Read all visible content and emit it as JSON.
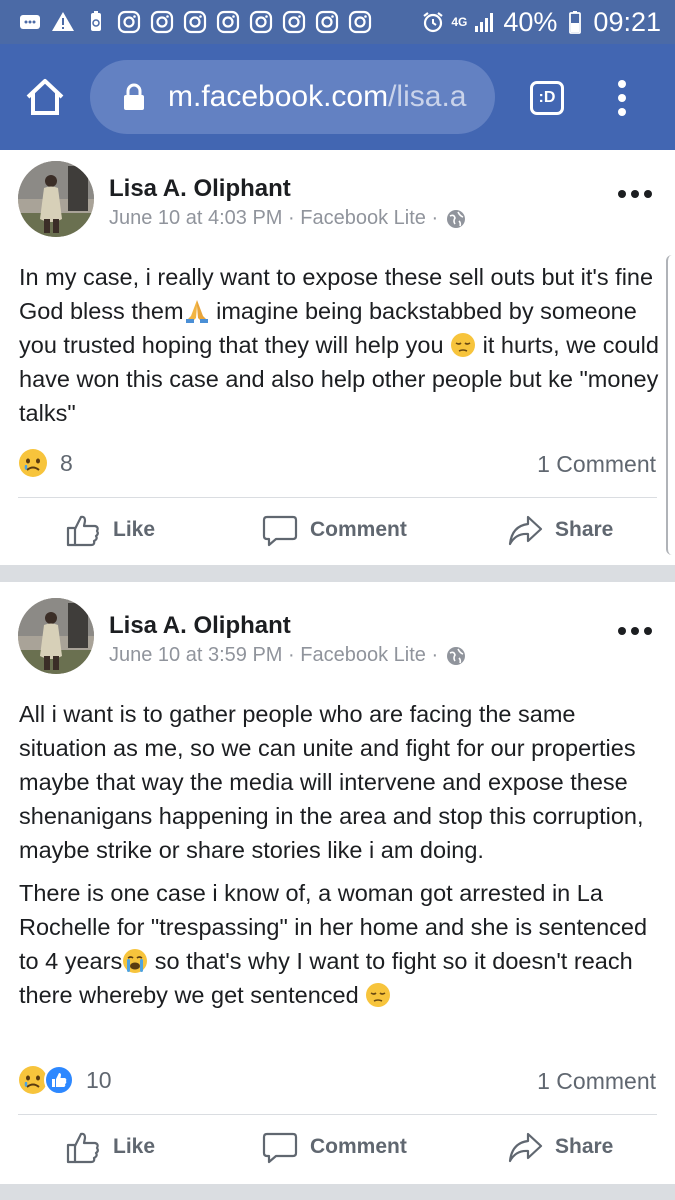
{
  "status_bar": {
    "network": "4G",
    "battery": "40%",
    "time": "09:21",
    "icons": [
      "messages-icon",
      "warning-icon",
      "battery-saver-icon",
      "instagram-icon",
      "instagram-icon",
      "instagram-icon",
      "instagram-icon",
      "instagram-icon",
      "instagram-icon",
      "instagram-icon",
      "instagram-icon",
      "alarm-icon",
      "signal-icon",
      "battery-icon"
    ]
  },
  "browser": {
    "url_host": "m.facebook.com",
    "url_path": "/lisa.a",
    "tab_label": ":D"
  },
  "posts": [
    {
      "author": "Lisa A. Oliphant",
      "date": "June 10 at 4:03 PM",
      "source": "Facebook Lite",
      "separator": "·",
      "text_1": "In my case, i really want to expose these sell outs but it's fine God bless them",
      "text_2": " imagine being backstabbed by someone you trusted hoping that they will help you ",
      "text_3": " it hurts, we could have won this case and also help other people but ke \"money talks\"",
      "reaction_count": "8",
      "comments": "1 Comment"
    },
    {
      "author": "Lisa A. Oliphant",
      "date": "June 10 at 3:59 PM",
      "source": "Facebook Lite",
      "separator": "·",
      "para1": "All i want is to gather people who are facing the same situation as me, so we can unite and fight for our properties maybe that way the media will intervene and expose these shenanigans happening in the area and stop this corruption, maybe strike or share stories like i am doing.",
      "para2_a": "There is one case i know of, a woman got arrested in La Rochelle for \"trespassing\" in her home and she is sentenced to 4 years",
      "para2_b": " so that's why I want to fight so it doesn't reach there whereby we get sentenced ",
      "reaction_count": "10",
      "comments": "1 Comment"
    }
  ],
  "actions": {
    "like": "Like",
    "comment": "Comment",
    "share": "Share"
  },
  "colors": {
    "facebook_blue": "#4266b2",
    "status_bar": "#4b6aa6",
    "text": "#1c1e21",
    "meta": "#90949c",
    "action": "#606770"
  }
}
